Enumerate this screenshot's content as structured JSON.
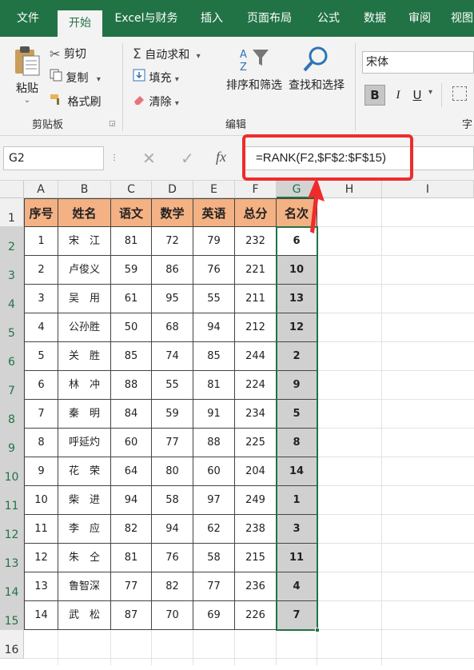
{
  "tabs": [
    "文件",
    "开始",
    "Excel与财务",
    "插入",
    "页面布局",
    "公式",
    "数据",
    "审阅",
    "视图"
  ],
  "ribbon": {
    "paste": "粘贴",
    "cut": "剪切",
    "copy": "复制",
    "format_painter": "格式刷",
    "clipboard_group": "剪贴板",
    "autosum": "自动求和",
    "fill": "填充",
    "clear": "清除",
    "sort_filter": "排序和筛选",
    "find_select": "查找和选择",
    "editing_group": "编辑",
    "font_name": "宋体",
    "font_group": "字",
    "bold": "B",
    "italic": "I",
    "underline": "U"
  },
  "formula_bar": {
    "name_box": "G2",
    "fx": "fx",
    "formula": "=RANK(F2,$F$2:$F$15)"
  },
  "columns": [
    "A",
    "B",
    "C",
    "D",
    "E",
    "F",
    "G",
    "H",
    "I"
  ],
  "rows": [
    "1",
    "2",
    "3",
    "4",
    "5",
    "6",
    "7",
    "8",
    "9",
    "10",
    "11",
    "12",
    "13",
    "14",
    "15",
    "16"
  ],
  "table": {
    "headers": [
      "序号",
      "姓名",
      "语文",
      "数学",
      "英语",
      "总分",
      "名次"
    ],
    "rows": [
      [
        "1",
        "宋　江",
        "81",
        "72",
        "79",
        "232",
        "6"
      ],
      [
        "2",
        "卢俊义",
        "59",
        "86",
        "76",
        "221",
        "10"
      ],
      [
        "3",
        "吴　用",
        "61",
        "95",
        "55",
        "211",
        "13"
      ],
      [
        "4",
        "公孙胜",
        "50",
        "68",
        "94",
        "212",
        "12"
      ],
      [
        "5",
        "关　胜",
        "85",
        "74",
        "85",
        "244",
        "2"
      ],
      [
        "6",
        "林　冲",
        "88",
        "55",
        "81",
        "224",
        "9"
      ],
      [
        "7",
        "秦　明",
        "84",
        "59",
        "91",
        "234",
        "5"
      ],
      [
        "8",
        "呼延灼",
        "60",
        "77",
        "88",
        "225",
        "8"
      ],
      [
        "9",
        "花　荣",
        "64",
        "80",
        "60",
        "204",
        "14"
      ],
      [
        "10",
        "柴　进",
        "94",
        "58",
        "97",
        "249",
        "1"
      ],
      [
        "11",
        "李　应",
        "82",
        "94",
        "62",
        "238",
        "3"
      ],
      [
        "12",
        "朱　仝",
        "81",
        "76",
        "58",
        "215",
        "11"
      ],
      [
        "13",
        "鲁智深",
        "77",
        "82",
        "77",
        "236",
        "4"
      ],
      [
        "14",
        "武　松",
        "87",
        "70",
        "69",
        "226",
        "7"
      ]
    ]
  },
  "colors": {
    "excel_green": "#217346",
    "header_fill": "#f4b183",
    "selection_fill": "#d0d0d0",
    "annotation_red": "#ef2b2b"
  }
}
